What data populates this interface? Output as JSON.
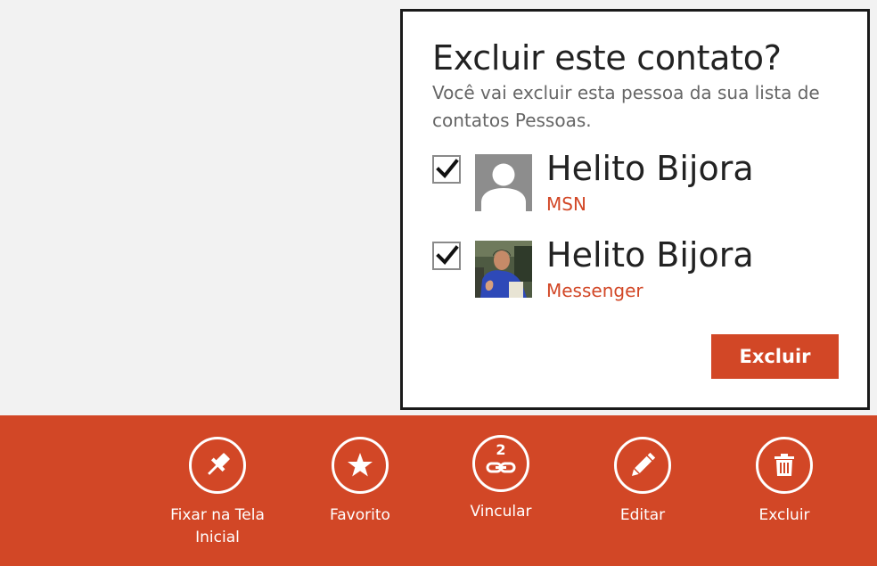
{
  "dialog": {
    "title": "Excluir este contato?",
    "description": "Você vai excluir esta pessoa da sua lista de contatos Pessoas.",
    "contacts": [
      {
        "name": "Helito Bijora",
        "source": "MSN",
        "checked": true,
        "avatar": "default-person-icon"
      },
      {
        "name": "Helito Bijora",
        "source": "Messenger",
        "checked": true,
        "avatar": "profile-photo"
      }
    ],
    "confirm_label": "Excluir"
  },
  "appbar": {
    "buttons": [
      {
        "label": "Fixar na Tela\nInicial",
        "icon": "pin-icon"
      },
      {
        "label": "Favorito",
        "icon": "star-icon"
      },
      {
        "label": "Vincular",
        "icon": "link-icon",
        "badge": "2"
      },
      {
        "label": "Editar",
        "icon": "pencil-icon"
      },
      {
        "label": "Excluir",
        "icon": "trash-icon"
      }
    ]
  },
  "colors": {
    "accent": "#d24726",
    "background": "#f2f2f2",
    "dialog_border": "#1a1a1a"
  }
}
